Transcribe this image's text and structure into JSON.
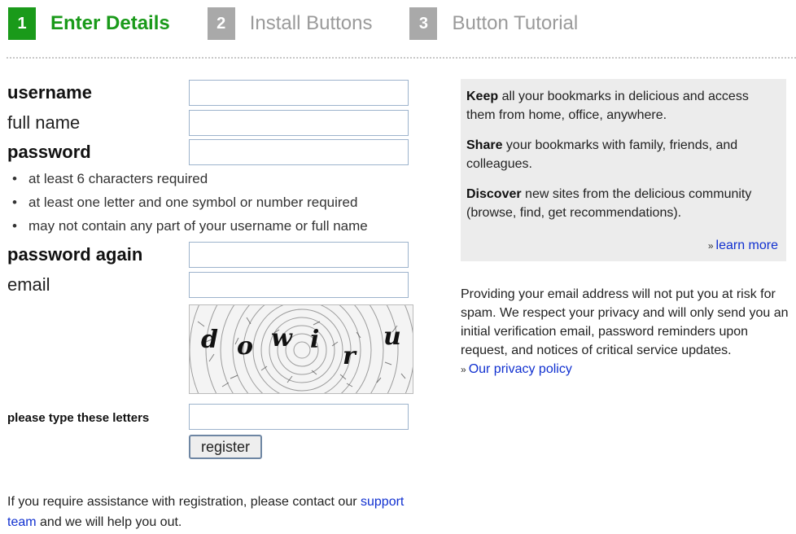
{
  "steps": [
    {
      "num": "1",
      "label": "Enter Details",
      "state": "active"
    },
    {
      "num": "2",
      "label": "Install Buttons",
      "state": "inactive"
    },
    {
      "num": "3",
      "label": "Button Tutorial",
      "state": "inactive"
    }
  ],
  "form": {
    "username_label": "username",
    "fullname_label": "full name",
    "password_label": "password",
    "password_rules": [
      "at least 6 characters required",
      "at least one letter and one symbol or number required",
      "may not contain any part of your username or full name"
    ],
    "password_again_label": "password again",
    "email_label": "email",
    "captcha_letters": [
      "d",
      "o",
      "w",
      "i",
      "r",
      "u"
    ],
    "captcha_prompt": "please type these letters",
    "register_label": "register",
    "values": {
      "username": "",
      "fullname": "",
      "password": "",
      "password_again": "",
      "email": "",
      "captcha": ""
    }
  },
  "help": {
    "text_before": "If you require assistance with registration, please contact our ",
    "link": "support team",
    "text_after": " and we will help you out."
  },
  "info": {
    "items": [
      {
        "bold": "Keep",
        "text": " all your bookmarks in delicious and access them from home, office, anywhere."
      },
      {
        "bold": "Share",
        "text": " your bookmarks with family, friends, and colleagues."
      },
      {
        "bold": "Discover",
        "text": " new sites from the delicious community (browse, find, get recommendations)."
      }
    ],
    "learn_more": "learn more",
    "arrow": "»"
  },
  "privacy": {
    "text": "Providing your email address will not put you at risk for spam. We respect your privacy and will only send you an initial verification email, password reminders upon request, and notices of critical service updates.",
    "link": "Our privacy policy"
  },
  "colors": {
    "active": "#1a9a1a",
    "inactive": "#a9a9a9",
    "link": "#1030d0"
  }
}
